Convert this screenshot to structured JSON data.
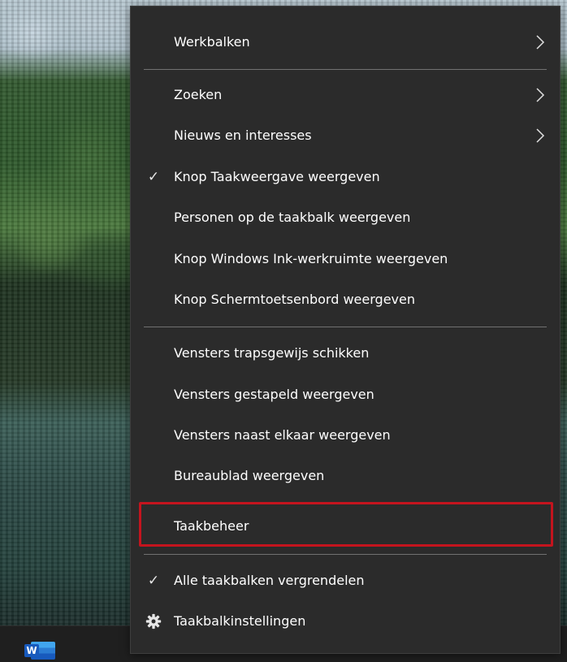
{
  "menu": {
    "items": [
      {
        "label": "Werkbalken",
        "checked": false,
        "has_submenu": true
      },
      {
        "label": "Zoeken",
        "checked": false,
        "has_submenu": true
      },
      {
        "label": "Nieuws en interesses",
        "checked": false,
        "has_submenu": true
      },
      {
        "label": "Knop Taakweergave weergeven",
        "checked": true,
        "has_submenu": false
      },
      {
        "label": "Personen op de taakbalk weergeven",
        "checked": false,
        "has_submenu": false
      },
      {
        "label": "Knop Windows Ink-werkruimte weergeven",
        "checked": false,
        "has_submenu": false
      },
      {
        "label": "Knop Schermtoetsenbord weergeven",
        "checked": false,
        "has_submenu": false
      },
      {
        "label": "Vensters trapsgewijs schikken",
        "checked": false,
        "has_submenu": false
      },
      {
        "label": "Vensters gestapeld weergeven",
        "checked": false,
        "has_submenu": false
      },
      {
        "label": "Vensters naast elkaar weergeven",
        "checked": false,
        "has_submenu": false
      },
      {
        "label": "Bureaublad weergeven",
        "checked": false,
        "has_submenu": false
      },
      {
        "label": "Taakbeheer",
        "checked": false,
        "has_submenu": false,
        "highlighted": true
      },
      {
        "label": "Alle taakbalken vergrendelen",
        "checked": true,
        "has_submenu": false
      },
      {
        "label": "Taakbalkinstellingen",
        "checked": false,
        "has_submenu": false,
        "icon": "gear-icon"
      }
    ],
    "check_glyph": "✓"
  },
  "taskbar": {
    "pinned_apps": [
      {
        "name": "Word",
        "icon": "word-icon",
        "glyph": "W"
      }
    ]
  },
  "colors": {
    "menu_background": "#2b2b2b",
    "menu_text": "#ffffff",
    "separator": "#717171",
    "highlight_border": "#c4141e",
    "taskbar": "#1f1f1f"
  }
}
